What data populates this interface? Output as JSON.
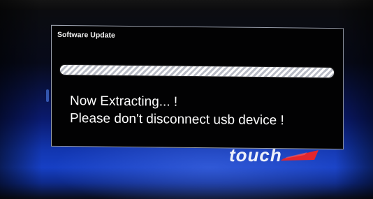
{
  "dialog": {
    "title": "Software Update",
    "progress_fraction": 1.0,
    "status_line": "Now Extracting... !",
    "warning_line": "Please don't disconnect usb device !"
  },
  "background": {
    "brand_word": "touch",
    "brand_colors": {
      "swoosh": "#e3262e",
      "screen_blue": "#163fc4"
    }
  }
}
